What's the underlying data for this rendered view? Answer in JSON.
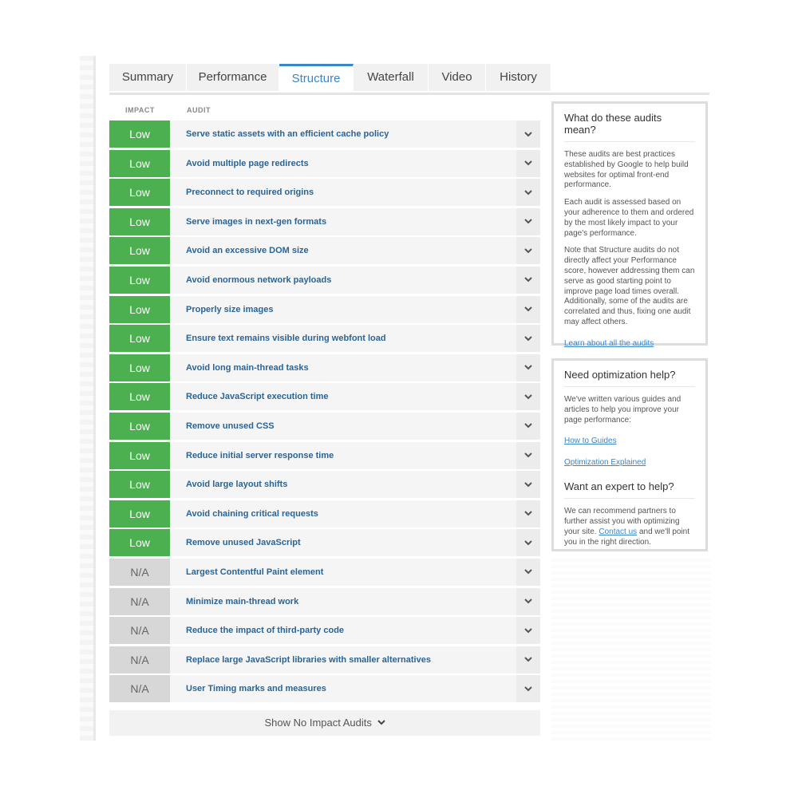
{
  "tabs": [
    {
      "label": "Summary",
      "active": false
    },
    {
      "label": "Performance",
      "active": false
    },
    {
      "label": "Structure",
      "active": true
    },
    {
      "label": "Waterfall",
      "active": false
    },
    {
      "label": "Video",
      "active": false
    },
    {
      "label": "History",
      "active": false
    }
  ],
  "table": {
    "impact_header": "IMPACT",
    "audit_header": "AUDIT"
  },
  "audits": [
    {
      "impact": "Low",
      "title": "Serve static assets with an efficient cache policy"
    },
    {
      "impact": "Low",
      "title": "Avoid multiple page redirects"
    },
    {
      "impact": "Low",
      "title": "Preconnect to required origins"
    },
    {
      "impact": "Low",
      "title": "Serve images in next-gen formats"
    },
    {
      "impact": "Low",
      "title": "Avoid an excessive DOM size"
    },
    {
      "impact": "Low",
      "title": "Avoid enormous network payloads"
    },
    {
      "impact": "Low",
      "title": "Properly size images"
    },
    {
      "impact": "Low",
      "title": "Ensure text remains visible during webfont load"
    },
    {
      "impact": "Low",
      "title": "Avoid long main-thread tasks"
    },
    {
      "impact": "Low",
      "title": "Reduce JavaScript execution time"
    },
    {
      "impact": "Low",
      "title": "Remove unused CSS"
    },
    {
      "impact": "Low",
      "title": "Reduce initial server response time"
    },
    {
      "impact": "Low",
      "title": "Avoid large layout shifts"
    },
    {
      "impact": "Low",
      "title": "Avoid chaining critical requests"
    },
    {
      "impact": "Low",
      "title": "Remove unused JavaScript"
    },
    {
      "impact": "N/A",
      "title": "Largest Contentful Paint element"
    },
    {
      "impact": "N/A",
      "title": "Minimize main-thread work"
    },
    {
      "impact": "N/A",
      "title": "Reduce the impact of third-party code"
    },
    {
      "impact": "N/A",
      "title": "Replace large JavaScript libraries with smaller alternatives"
    },
    {
      "impact": "N/A",
      "title": "User Timing marks and measures"
    }
  ],
  "show_more_label": "Show No Impact Audits",
  "colors": {
    "low": "#4caf50",
    "na": "#d7d7d7",
    "accent": "#3a86c8",
    "audit_title": "#2a6496"
  },
  "icons": {
    "row_toggle": "chevron-down-icon",
    "show_more": "chevron-down-icon"
  },
  "panel_audits": {
    "title": "What do these audits mean?",
    "p1": "These audits are best practices established by Google to help build websites for optimal front-end performance.",
    "p2": "Each audit is assessed based on your adherence to them and ordered by the most likely impact to your page's performance.",
    "p3": "Note that Structure audits do not directly affect your Performance score, however addressing them can serve as good starting point to improve page load times overall. Additionally, some of the audits are correlated and thus, fixing one audit may affect others.",
    "link": "Learn about all the audits"
  },
  "panel_help": {
    "title": "Need optimization help?",
    "p1": "We've written various guides and articles to help you improve your page performance:",
    "link1": "How to Guides",
    "link2": "Optimization Explained",
    "title2": "Want an expert to help?",
    "p2_before": "We can recommend partners to further assist you with optimizing your site.",
    "p2_link": "Contact us",
    "p2_after": "and we'll point you in the right direction."
  }
}
